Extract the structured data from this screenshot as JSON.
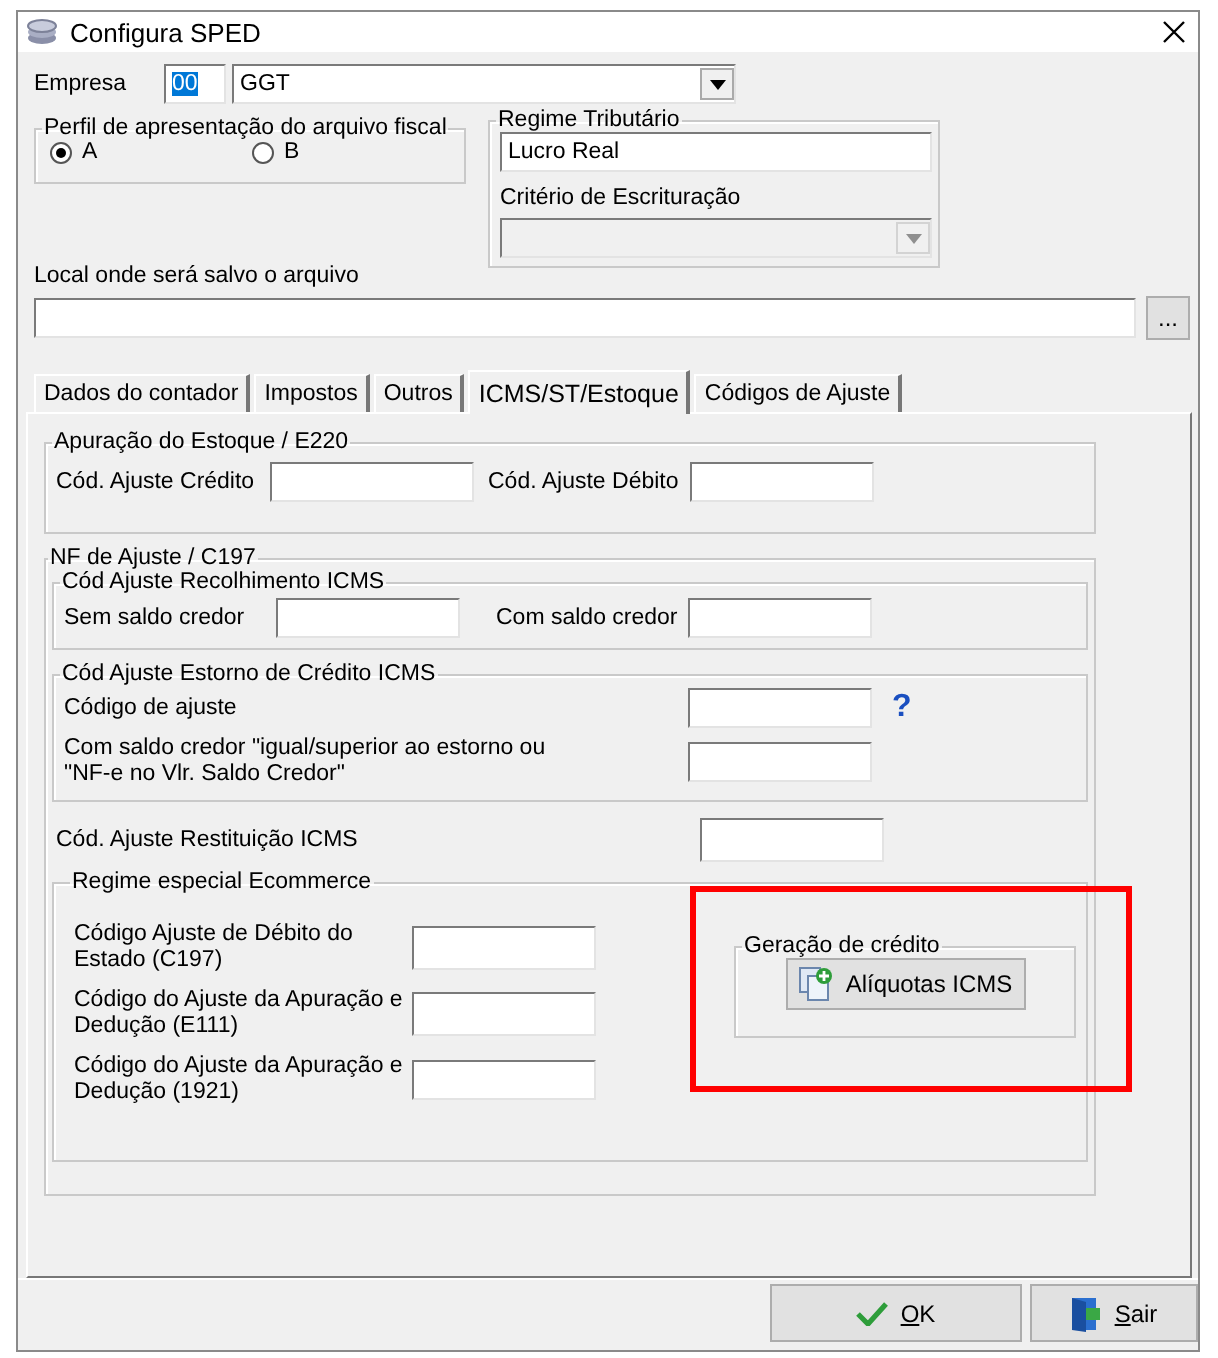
{
  "window": {
    "title": "Configura SPED"
  },
  "empresa": {
    "label": "Empresa",
    "code": "00",
    "name": "GGT"
  },
  "perfil": {
    "title": "Perfil de apresentação do arquivo fiscal",
    "options": [
      {
        "label": "A",
        "selected": true
      },
      {
        "label": "B",
        "selected": false
      }
    ]
  },
  "regime": {
    "title": "Regime Tributário",
    "value": "Lucro Real",
    "criterio_label": "Critério de Escrituração",
    "criterio_disabled": true
  },
  "local": {
    "label": "Local onde será salvo o arquivo",
    "browse": "..."
  },
  "tabs": [
    {
      "label": "Dados do contador",
      "selected": false
    },
    {
      "label": "Impostos",
      "selected": false
    },
    {
      "label": "Outros",
      "selected": false
    },
    {
      "label": "ICMS/ST/Estoque",
      "selected": true
    },
    {
      "label": "Códigos de Ajuste",
      "selected": false
    }
  ],
  "apuracao": {
    "title": "Apuração do Estoque / E220",
    "fields": [
      "Cód. Ajuste Crédito",
      "Cód. Ajuste Débito"
    ]
  },
  "nf_ajuste": {
    "title": "NF de Ajuste / C197",
    "recolhimento": {
      "title": "Cód Ajuste Recolhimento ICMS",
      "fields": [
        "Sem saldo credor",
        "Com saldo credor"
      ]
    },
    "estorno": {
      "title": "Cód Ajuste Estorno de Crédito ICMS",
      "rows": [
        {
          "label": "Código de ajuste",
          "help": "?"
        },
        {
          "label": "Com saldo credor \"igual/superior ao estorno ou\n\"NF-e no Vlr. Saldo Credor\""
        }
      ]
    },
    "restituicao": {
      "label": "Cód. Ajuste Restituição ICMS"
    },
    "ecommerce": {
      "title": "Regime especial Ecommerce",
      "fields": [
        "Código Ajuste de Débito do Estado (C197)",
        "Código do Ajuste da Apuração e Dedução (E111)",
        "Código do Ajuste da Apuração e Dedução (1921)"
      ],
      "geracao": {
        "title": "Geração de crédito",
        "button": "Alíquotas ICMS",
        "highlighted": true
      }
    }
  },
  "buttons": [
    {
      "label": "OK",
      "kind": "ok"
    },
    {
      "label": "Sair",
      "kind": "exit"
    }
  ]
}
